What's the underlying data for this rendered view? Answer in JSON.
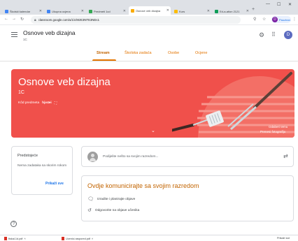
{
  "browser": {
    "tabs": [
      {
        "label": "Školski kalendar",
        "color": "#4285f4",
        "active": false
      },
      {
        "label": "Ukupna ocjena",
        "color": "#4285f4",
        "active": false
      },
      {
        "label": "Predmeti 1cd",
        "color": "#34a853",
        "active": false
      },
      {
        "label": "Osnove veb dizajna",
        "color": "#f9ab00",
        "active": true
      },
      {
        "label": "Kurs",
        "color": "#fbbc04",
        "active": false
      },
      {
        "label": "Ed-a-ation 2121",
        "color": "#0f9d58",
        "active": false
      }
    ],
    "new_tab": "+",
    "url": "classroom.google.com/u/1/c/MzE3NTE3NDc1",
    "profile_name": "Pauziran",
    "profile_initial": "D"
  },
  "header": {
    "course_title": "Osnove veb dizajna",
    "course_subtitle": "1C",
    "user_initial": "D"
  },
  "nav_tabs": [
    "Stream",
    "Školska zadaća",
    "Osobe",
    "Ocjene"
  ],
  "banner": {
    "title": "Osnove veb dizajna",
    "section": "1C",
    "code_label": "Kôd predmeta",
    "code_value": "hjv4ei",
    "select_theme": "Odaberi temu",
    "upload_photo": "Prenesi fotografiju",
    "color": "#f0504b"
  },
  "upcoming": {
    "title": "Predstojeće",
    "empty_text": "Nema zadataka sa skorim rokom",
    "view_all": "Prikaži sve"
  },
  "announce": {
    "placeholder": "Podijelite nešto sa svojim razredom..."
  },
  "communicate": {
    "title": "Ovdje komunicirajte sa svojim razredom",
    "items": [
      "Izradite i planirajte objave",
      "Odgovorite na objave učenika"
    ]
  },
  "downloads": {
    "items": [
      "fiskal-1d.pdf",
      "Ucenici-raspored.pdf"
    ],
    "show_all": "Prikaži sve"
  }
}
